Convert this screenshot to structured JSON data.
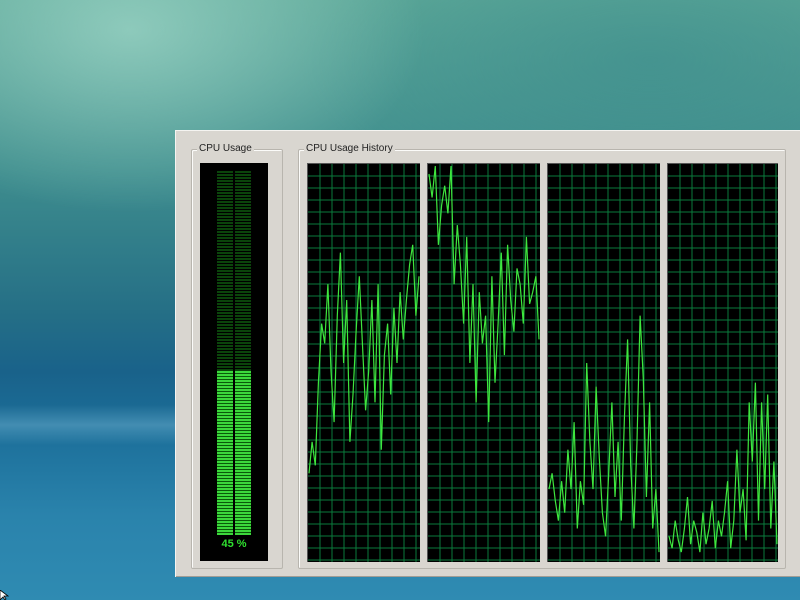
{
  "window": {
    "cpu_usage": {
      "label": "CPU Usage",
      "percent": 45,
      "display": "45 %"
    },
    "cpu_history": {
      "label": "CPU Usage History",
      "cores": [
        {
          "values": [
            22,
            30,
            24,
            45,
            60,
            55,
            70,
            48,
            35,
            62,
            78,
            50,
            66,
            30,
            42,
            58,
            72,
            55,
            38,
            48,
            66,
            40,
            70,
            28,
            52,
            60,
            42,
            64,
            50,
            68,
            56,
            66,
            75,
            80,
            62,
            72
          ]
        },
        {
          "values": [
            98,
            92,
            100,
            80,
            90,
            95,
            88,
            100,
            70,
            85,
            75,
            60,
            82,
            50,
            70,
            40,
            68,
            55,
            62,
            35,
            72,
            45,
            60,
            78,
            52,
            80,
            66,
            58,
            74,
            70,
            60,
            82,
            65,
            68,
            72,
            56
          ]
        },
        {
          "values": [
            18,
            22,
            15,
            10,
            20,
            12,
            28,
            18,
            35,
            8,
            20,
            14,
            50,
            30,
            18,
            44,
            26,
            12,
            6,
            22,
            40,
            16,
            30,
            10,
            36,
            56,
            24,
            8,
            30,
            62,
            46,
            16,
            40,
            8,
            18,
            2
          ]
        },
        {
          "values": [
            6,
            3,
            10,
            5,
            2,
            8,
            16,
            4,
            10,
            7,
            2,
            12,
            4,
            8,
            15,
            3,
            10,
            6,
            12,
            20,
            3,
            10,
            28,
            12,
            18,
            5,
            40,
            25,
            45,
            10,
            40,
            18,
            42,
            8,
            25,
            4
          ]
        }
      ]
    }
  },
  "colors": {
    "graph_background": "#000000",
    "grid": "#0a7a3c",
    "line": "#3ee63e",
    "meter_active": "#3cd83c",
    "meter_inactive": "#0b440b",
    "window_face": "#d9d6d0"
  }
}
